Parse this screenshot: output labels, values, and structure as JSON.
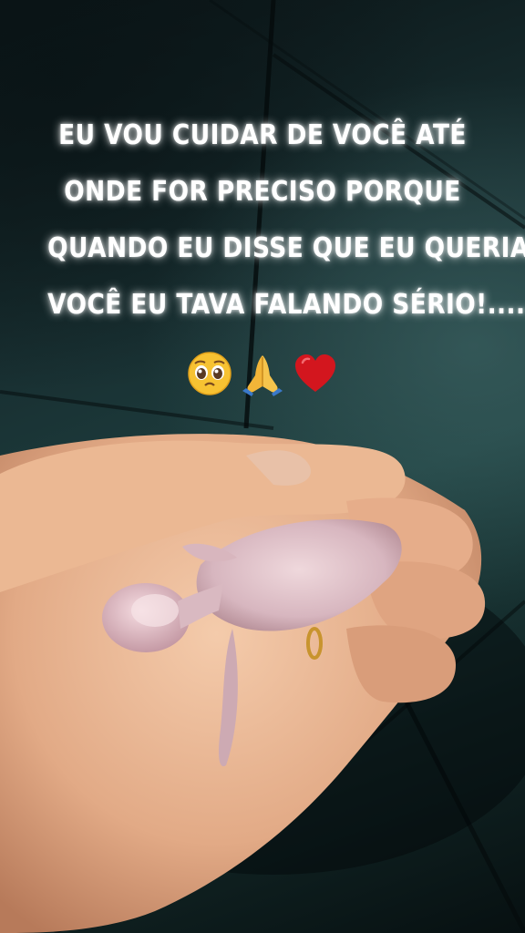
{
  "caption": {
    "lines": [
      "EU VOU CUIDAR DE VOCÊ ATÉ",
      "ONDE FOR PRECISO PORQUE",
      "QUANDO EU DISSE QUE EU QUERIA",
      "VOCÊ EU TAVA FALANDO SÉRIO!......"
    ]
  },
  "emojis": [
    {
      "icon": "pleading-face-icon"
    },
    {
      "icon": "folded-hands-icon"
    },
    {
      "icon": "red-heart-icon"
    }
  ],
  "colors": {
    "background": "#193133",
    "caption_text": "#ffffff",
    "skin": "#e9b894",
    "chick": "#d9bcc4",
    "heart": "#d3161e"
  }
}
